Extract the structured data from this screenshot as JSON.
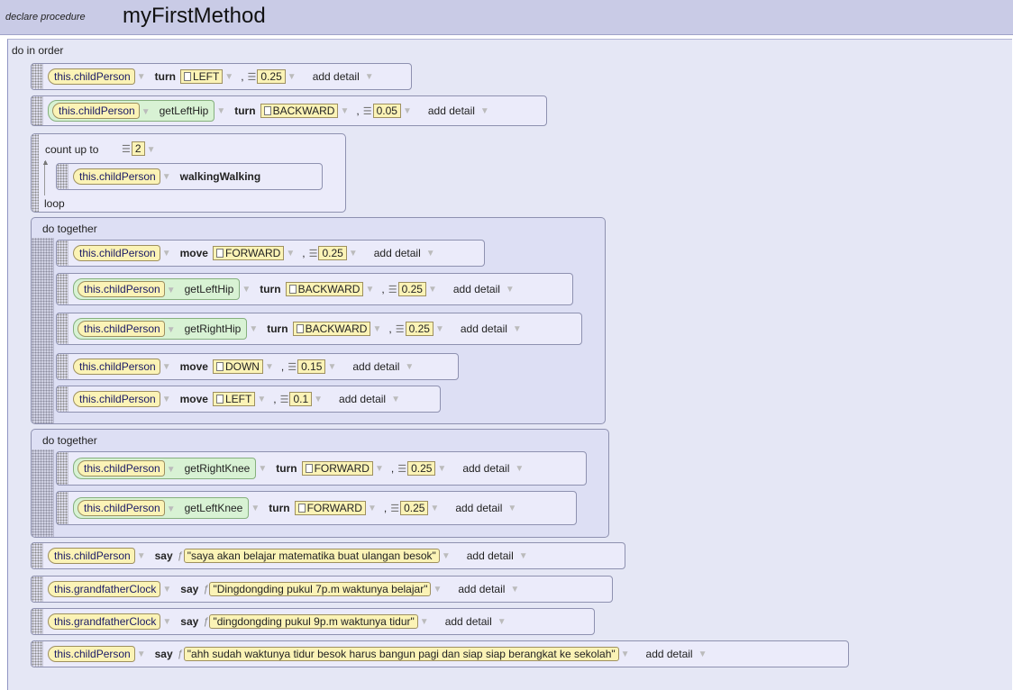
{
  "header": {
    "keyword": "declare procedure",
    "method_name": "myFirstMethod"
  },
  "do_in_order_label": "do in order",
  "common": {
    "add_detail": "add detail",
    "comma": ","
  },
  "rows": {
    "r1": {
      "obj": "this.childPerson",
      "method": "turn",
      "dir": "LEFT",
      "amount": "0.25"
    },
    "r2": {
      "obj": "this.childPerson",
      "getter": "getLeftHip",
      "method": "turn",
      "dir": "BACKWARD",
      "amount": "0.05"
    },
    "loop": {
      "label": "count up to",
      "count": "2",
      "end": "loop",
      "obj": "this.childPerson",
      "method": "walkingWalking"
    },
    "dt1": {
      "label": "do together",
      "a": {
        "obj": "this.childPerson",
        "method": "move",
        "dir": "FORWARD",
        "amount": "0.25"
      },
      "b": {
        "obj": "this.childPerson",
        "getter": "getLeftHip",
        "method": "turn",
        "dir": "BACKWARD",
        "amount": "0.25"
      },
      "c": {
        "obj": "this.childPerson",
        "getter": "getRightHip",
        "method": "turn",
        "dir": "BACKWARD",
        "amount": "0.25"
      },
      "d": {
        "obj": "this.childPerson",
        "method": "move",
        "dir": "DOWN",
        "amount": "0.15"
      },
      "e": {
        "obj": "this.childPerson",
        "method": "move",
        "dir": "LEFT",
        "amount": "0.1"
      }
    },
    "dt2": {
      "label": "do together",
      "a": {
        "obj": "this.childPerson",
        "getter": "getRightKnee",
        "method": "turn",
        "dir": "FORWARD",
        "amount": "0.25"
      },
      "b": {
        "obj": "this.childPerson",
        "getter": "getLeftKnee",
        "method": "turn",
        "dir": "FORWARD",
        "amount": "0.25"
      }
    },
    "s1": {
      "obj": "this.childPerson",
      "method": "say",
      "text": "\"saya akan belajar matematika buat ulangan besok\""
    },
    "s2": {
      "obj": "this.grandfatherClock",
      "method": "say",
      "text": "\"Dingdongding pukul 7p.m waktunya belajar\""
    },
    "s3": {
      "obj": "this.grandfatherClock",
      "method": "say",
      "text": "\"dingdongding pukul 9p.m waktunya tidur\""
    },
    "s4": {
      "obj": "this.childPerson",
      "method": "say",
      "text": "\"ahh sudah waktunya tidur besok harus bangun pagi dan siap siap berangkat ke sekolah\""
    }
  }
}
